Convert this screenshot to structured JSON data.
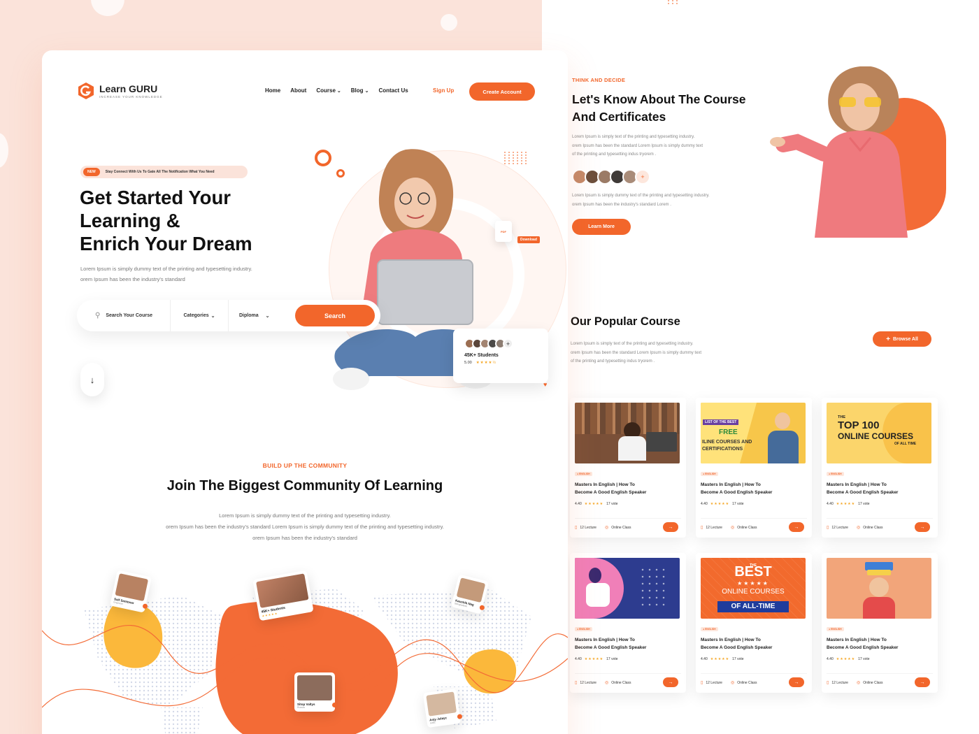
{
  "brand": {
    "name": "Learn GURU",
    "tagline": "INCREASE YOUR KNOWLEDGE",
    "accent": "#f2662b",
    "accent_light": "#fbe3da",
    "yellow": "#fbb83b"
  },
  "nav": {
    "items": [
      {
        "label": "Home",
        "has_dropdown": false
      },
      {
        "label": "About",
        "has_dropdown": false
      },
      {
        "label": "Course",
        "has_dropdown": true
      },
      {
        "label": "Blog",
        "has_dropdown": true
      },
      {
        "label": "Contact Us",
        "has_dropdown": false
      }
    ],
    "signup": "Sign Up",
    "create_account": "Create Account"
  },
  "hero": {
    "badge": "NEW",
    "notice": "Stay Connect With Us To Gate All The Notification What You Need",
    "title_line1": "Get Started Your",
    "title_line2": "Learning &",
    "title_line3": "Enrich Your Dream",
    "desc_line1": "Lorem Ipsum is simply dummy text of the printing and typesetting industry.",
    "desc_line2": "orem Ipsum has been the industry's standard",
    "download": "Download",
    "download_icon_text": "PDF",
    "students_label": "45K+ Students",
    "rating": "5.00"
  },
  "search": {
    "placeholder": "Search Your Course",
    "category": "Categories",
    "degree": "Diploma",
    "button": "Search"
  },
  "community": {
    "eyebrow": "BUILD UP THE COMMUNITY",
    "title": "Join The Biggest Community Of Learning",
    "desc_line1": "Lorem Ipsum is simply dummy text of the printing and typesetting industry.",
    "desc_line2": "orem Ipsum has been the industry's standard Lorem Ipsum is simply dummy text of the printing and typesetting industry.",
    "desc_line3": "orem Ipsum has been the industry's standard",
    "group_card_label": "45K+ Students",
    "members": [
      {
        "name": "Saif Santonar",
        "role": "Engineer"
      },
      {
        "name": "Kaushik Nag",
        "role": "Bangladesh"
      },
      {
        "name": "Sitop Valtys",
        "role": "Russia"
      },
      {
        "name": "Anjy Julayz",
        "role": "India"
      }
    ]
  },
  "about": {
    "eyebrow": "THINK AND DECIDE",
    "title_line1": "Let's Know About The Course",
    "title_line2": "And Certificates",
    "desc1_line1": "Lorem Ipsum is simply text of the printing and typesetting industry.",
    "desc1_line2": "orem Ipsum has been the standard Lorem Ipsum is simply dummy text",
    "desc1_line3": "of the printing and typesetting indus tryorem .",
    "desc2_line1": "Lorem Ipsum is simply dummy text of the printing and typesetting industry.",
    "desc2_line2": "orem Ipsum has been the industry's standard Lorem .",
    "learn_more": "Learn More"
  },
  "popular": {
    "title": "Our Popular Course",
    "desc_line1": "Lorem Ipsum is simply text of the printing and typesetting industry.",
    "desc_line2": "orem Ipsum has been the standard Lorem Ipsum is simply dummy text",
    "desc_line3": "of the printing and typesetting indus tryorem .",
    "browse_all": "Browse All",
    "courses": [
      {
        "thumb_line1": "",
        "thumb_line2": "",
        "thumb_line3": "",
        "thumb_line4": "",
        "tag": "ENGLISH",
        "title_line1": "Masters In English | How To",
        "title_line2": "Become A Good English Speaker",
        "rating": "4.40",
        "votes": "17 vote",
        "lectures": "12 Lecture",
        "mode": "Online Class"
      },
      {
        "thumb_line1": "LIST OF THE BEST",
        "thumb_line2": "FREE",
        "thumb_line3": "ILINE COURSES AND",
        "thumb_line4": "CERTIFICATIONS",
        "tag": "ENGLISH",
        "title_line1": "Masters In English | How To",
        "title_line2": "Become A Good English Speaker",
        "rating": "4.40",
        "votes": "17 vote",
        "lectures": "12 Lecture",
        "mode": "Online Class"
      },
      {
        "thumb_line1": "THE",
        "thumb_line2": "TOP 100",
        "thumb_line3": "ONLINE COURSES",
        "thumb_line4": "OF ALL TIME",
        "tag": "ENGLISH",
        "title_line1": "Masters In English | How To",
        "title_line2": "Become A Good English Speaker",
        "rating": "4.40",
        "votes": "17 vote",
        "lectures": "12 Lecture",
        "mode": "Online Class"
      },
      {
        "thumb_line1": "",
        "thumb_line2": "",
        "thumb_line3": "",
        "thumb_line4": "",
        "tag": "ENGLISH",
        "title_line1": "Masters In English | How To",
        "title_line2": "Become A Good English Speaker",
        "rating": "4.40",
        "votes": "17 vote",
        "lectures": "12 Lecture",
        "mode": "Online Class"
      },
      {
        "thumb_line1": "THE",
        "thumb_line2": "BEST",
        "thumb_line3": "ONLINE COURSES",
        "thumb_line4": "OF ALL-TIME",
        "tag": "ENGLISH",
        "title_line1": "Masters In English | How To",
        "title_line2": "Become A Good English Speaker",
        "rating": "4.40",
        "votes": "17 vote",
        "lectures": "12 Lecture",
        "mode": "Online Class"
      },
      {
        "thumb_line1": "",
        "thumb_line2": "",
        "thumb_line3": "",
        "thumb_line4": "",
        "tag": "ENGLISH",
        "title_line1": "Masters In English | How To",
        "title_line2": "Become A Good English Speaker",
        "rating": "4.40",
        "votes": "17 vote",
        "lectures": "12 Lecture",
        "mode": "Online Class"
      }
    ]
  }
}
